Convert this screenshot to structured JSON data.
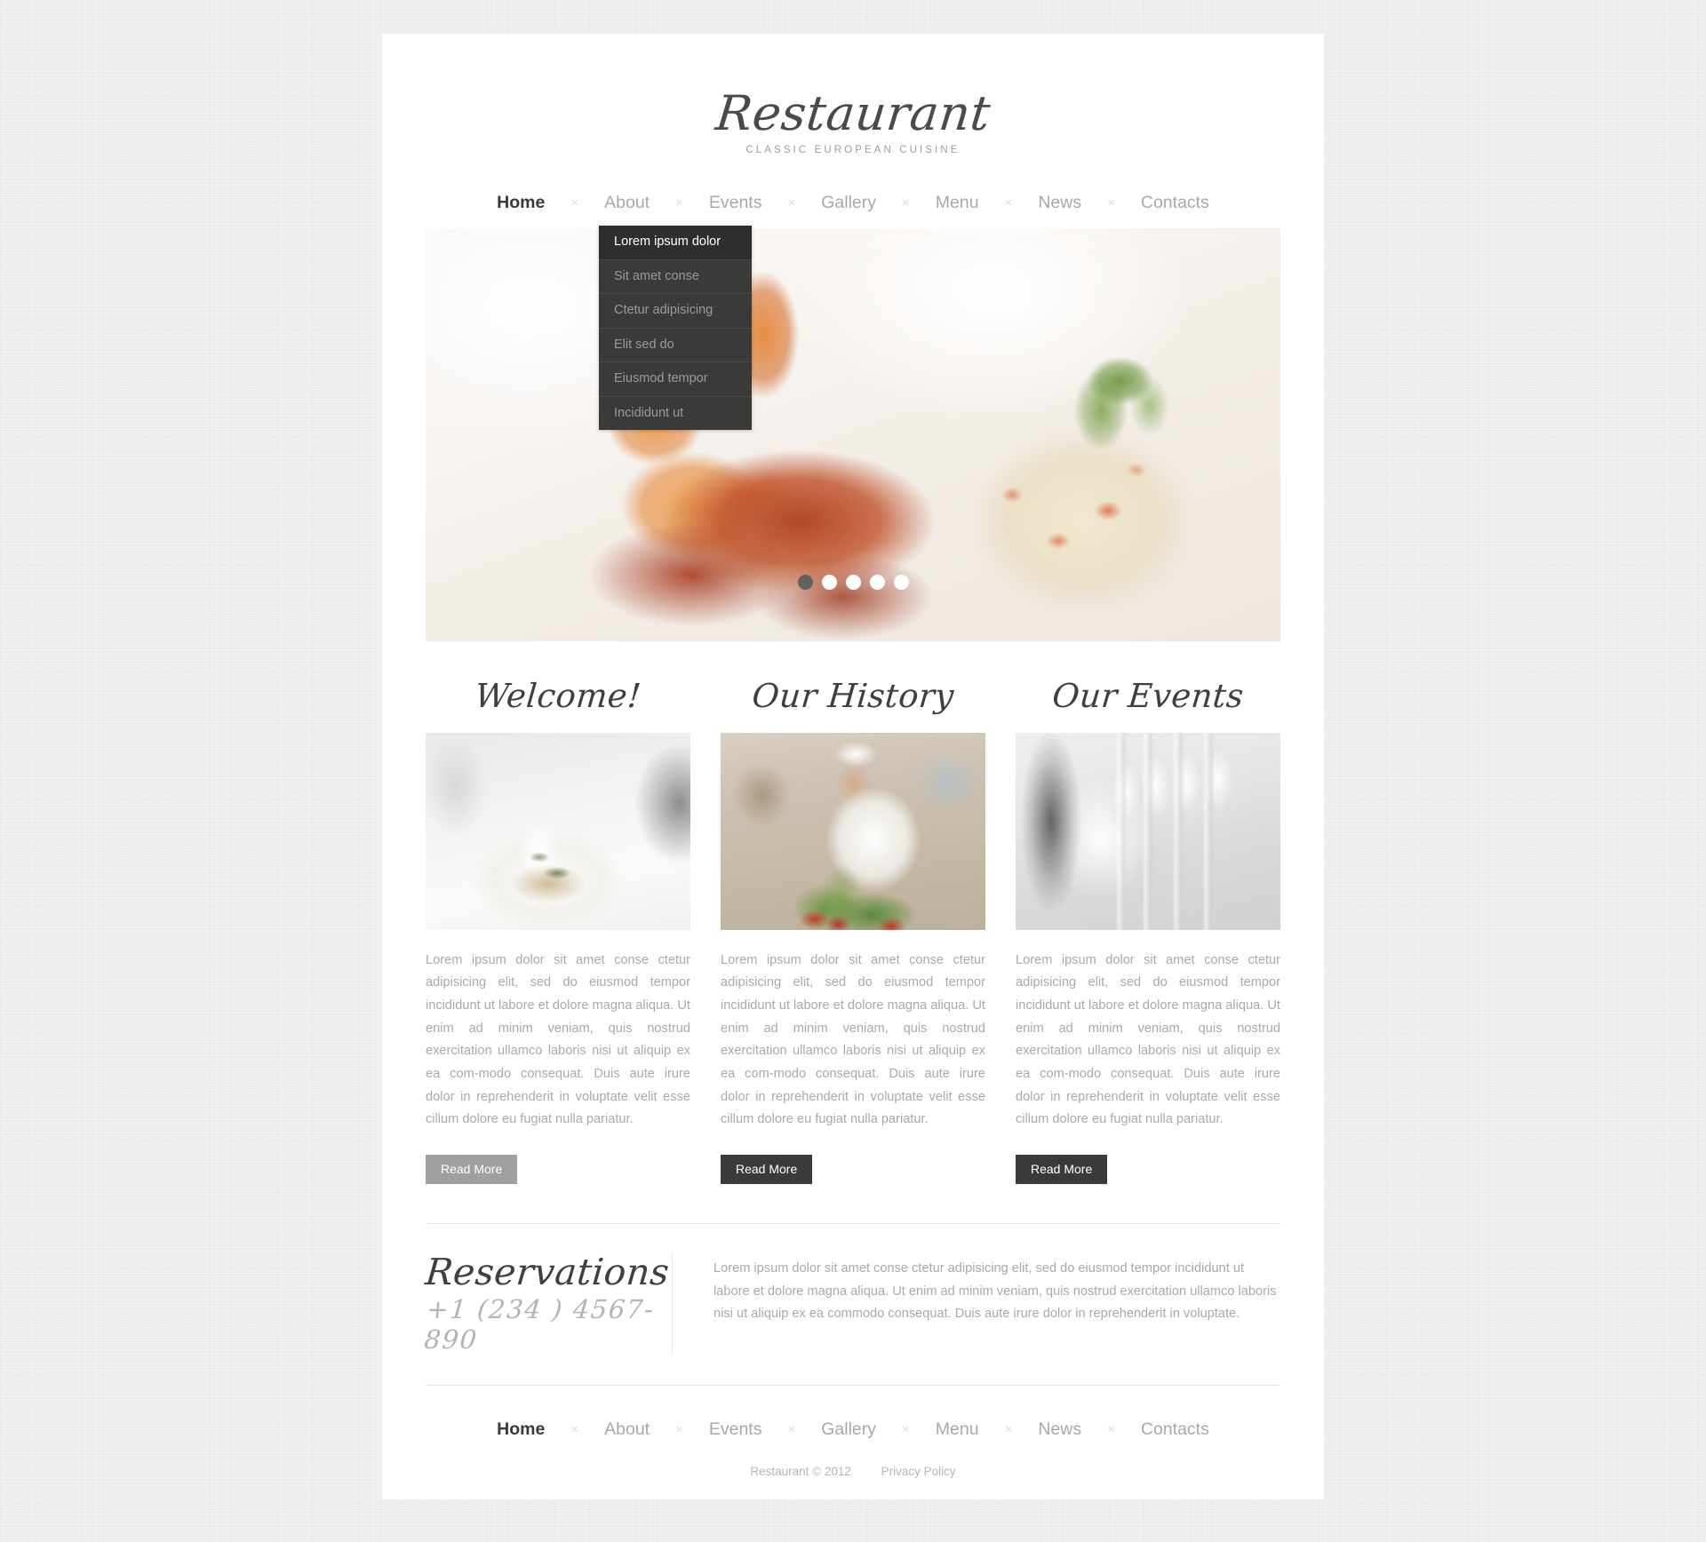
{
  "site": {
    "logo_name": "Restaurant",
    "logo_tagline": "CLASSIC EUROPEAN CUISINE"
  },
  "nav": {
    "separator": "×",
    "items": [
      {
        "label": "Home",
        "active": true
      },
      {
        "label": "About",
        "active": false
      },
      {
        "label": "Events",
        "active": false
      },
      {
        "label": "Gallery",
        "active": false
      },
      {
        "label": "Menu",
        "active": false
      },
      {
        "label": "News",
        "active": false
      },
      {
        "label": "Contacts",
        "active": false
      }
    ]
  },
  "dropdown": {
    "parent": "About",
    "items": [
      {
        "label": "Lorem ipsum dolor",
        "active": true
      },
      {
        "label": "Sit amet conse",
        "active": false
      },
      {
        "label": "Ctetur adipisicing",
        "active": false
      },
      {
        "label": "Elit sed do",
        "active": false
      },
      {
        "label": "Eiusmod tempor",
        "active": false
      },
      {
        "label": "Incididunt ut",
        "active": false
      }
    ]
  },
  "slider": {
    "image_alt": "grilled-shrimp-in-sauce-with-salad",
    "slide_count": 5,
    "active_slide": 1
  },
  "columns": [
    {
      "title": "Welcome!",
      "image_alt": "plated-dish-on-white-table",
      "text": "Lorem ipsum dolor sit amet conse ctetur adipisicing elit, sed do eiusmod tempor incididunt ut labore et dolore magna aliqua. Ut enim ad minim veniam, quis nostrud exercitation ullamco laboris nisi ut aliquip ex ea com-modo consequat. Duis aute irure dolor in reprehenderit in voluptate velit esse cillum dolore eu fugiat nulla pariatur.",
      "button_label": "Read More",
      "button_hovered": true
    },
    {
      "title": "Our History",
      "image_alt": "smiling-chef-with-vegetables",
      "text": "Lorem ipsum dolor sit amet conse ctetur adipisicing elit, sed do eiusmod tempor incididunt ut labore et dolore magna aliqua. Ut enim ad minim veniam, quis nostrud exercitation ullamco laboris nisi ut aliquip ex ea com-modo consequat. Duis aute irure dolor in reprehenderit in voluptate velit esse cillum dolore eu fugiat nulla pariatur.",
      "button_label": "Read More",
      "button_hovered": false
    },
    {
      "title": "Our Events",
      "image_alt": "wine-glasses-on-set-table",
      "text": "Lorem ipsum dolor sit amet conse ctetur adipisicing elit, sed do eiusmod tempor incididunt ut labore et dolore magna aliqua. Ut enim ad minim veniam, quis nostrud exercitation ullamco laboris nisi ut aliquip ex ea com-modo consequat. Duis aute irure dolor in reprehenderit in voluptate velit esse cillum dolore eu fugiat nulla pariatur.",
      "button_label": "Read More",
      "button_hovered": false
    }
  ],
  "reservations": {
    "title": "Reservations",
    "phone": "+1 (234 ) 4567-890",
    "text": "Lorem ipsum dolor sit amet conse ctetur adipisicing elit, sed do eiusmod tempor incididunt ut labore et dolore magna aliqua. Ut enim ad minim veniam, quis nostrud exercitation ullamco laboris nisi ut aliquip ex ea commodo consequat. Duis aute irure dolor in reprehenderit in voluptate."
  },
  "footer": {
    "nav": {
      "separator": "×",
      "items": [
        {
          "label": "Home",
          "active": true
        },
        {
          "label": "About",
          "active": false
        },
        {
          "label": "Events",
          "active": false
        },
        {
          "label": "Gallery",
          "active": false
        },
        {
          "label": "Menu",
          "active": false
        },
        {
          "label": "News",
          "active": false
        },
        {
          "label": "Contacts",
          "active": false
        }
      ]
    },
    "copyright": "Restaurant © 2012",
    "privacy_label": "Privacy Policy"
  },
  "colors": {
    "page_background": "#f1f1f1",
    "content_background": "#ffffff",
    "dark_accent": "#3a3a38",
    "body_text": "#a9a9a9",
    "heading_text": "#3f3f3f",
    "muted_nav": "#a8a8a8",
    "button_hover": "#a0a0a0"
  }
}
